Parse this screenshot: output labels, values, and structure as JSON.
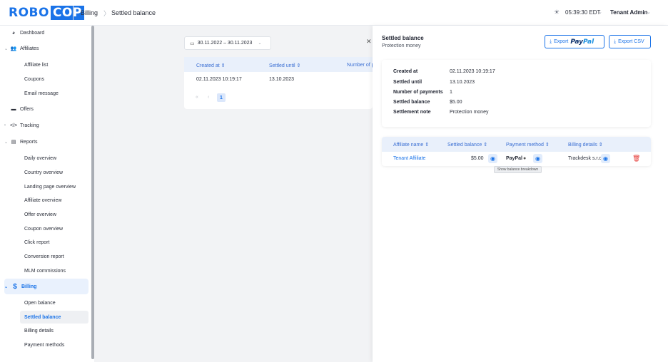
{
  "header": {
    "logo_part1": "ROBO",
    "logo_part2": "COP",
    "breadcrumb_1": "Billing",
    "breadcrumb_sep": "〉",
    "breadcrumb_2": "Settled balance",
    "time": "05:39:30 EDT",
    "user": "Tenant Admin"
  },
  "sidebar": {
    "dashboard": "Dashboard",
    "affiliates": "Affiliates",
    "affiliate_list": "Affiliate list",
    "coupons": "Coupons",
    "email_message": "Email message",
    "offers": "Offers",
    "tracking": "Tracking",
    "reports": "Reports",
    "daily_overview": "Daily overview",
    "country_overview": "Country overview",
    "landing_page_overview": "Landing page overview",
    "affiliate_overview": "Affiliate overview",
    "offer_overview": "Offer overview",
    "coupon_overview": "Coupon overview",
    "click_report": "Click report",
    "conversion_report": "Conversion report",
    "mlm_commissions": "MLM commissions",
    "billing": "Billing",
    "open_balance": "Open balance",
    "settled_balance": "Settled balance",
    "billing_details": "Billing details",
    "payment_methods": "Payment methods"
  },
  "filters": {
    "date_range": "30.11.2022 – 30.11.2023"
  },
  "main_table": {
    "col_created": "Created at ⇕",
    "col_settled": "Settled until ⇕",
    "col_number": "Number of p",
    "row_created": "02.11.2023 10:19:17",
    "row_settled": "13.10.2023",
    "page_first": "«",
    "page_prev": "‹",
    "page_current": "1"
  },
  "drawer": {
    "title": "Settled balance",
    "subtitle": "Protection money",
    "export_paypal_label": "Export",
    "paypal_a": "Pay",
    "paypal_b": "Pal",
    "export_csv_label": "Export CSV",
    "details": {
      "created_at_k": "Created at",
      "created_at_v": "02.11.2023 10:19:17",
      "settled_until_k": "Settled until",
      "settled_until_v": "13.10.2023",
      "num_payments_k": "Number of payments",
      "num_payments_v": "1",
      "settled_balance_k": "Settled balance",
      "settled_balance_v": "$5.00",
      "settlement_note_k": "Settlement note",
      "settlement_note_v": "Protection money"
    },
    "table": {
      "col_affiliate": "Affiliate name ⇕",
      "col_balance": "Settled balance ⇕",
      "col_method": "Payment method ⇕",
      "col_billing": "Billing details ⇕",
      "affiliate": "Tenant Affiliate",
      "balance": "$5.00",
      "method": "PayPal",
      "billing": "Trackdesk s.r.o.",
      "tooltip": "Show balance breakdown"
    }
  },
  "colors": {
    "accent": "#1a73e8",
    "danger": "#e53935"
  }
}
